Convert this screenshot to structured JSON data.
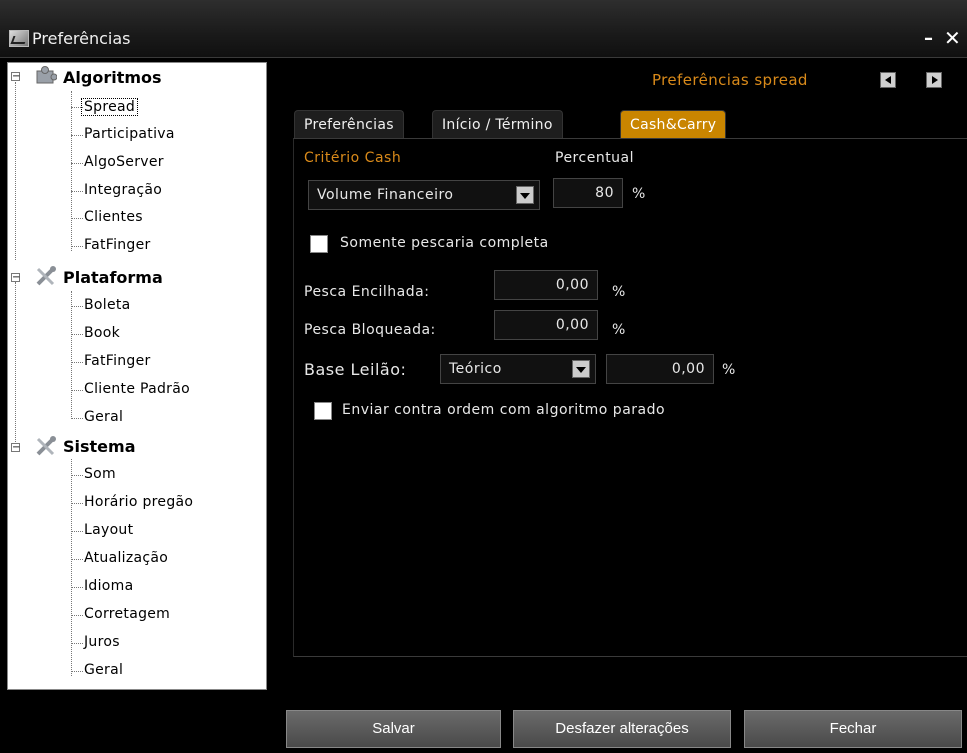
{
  "window": {
    "title": "Preferências"
  },
  "tree": {
    "categories": [
      {
        "label": "Algoritmos",
        "icon": "puzzle-icon",
        "items": [
          "Spread",
          "Participativa",
          "AlgoServer",
          "Integração",
          "Clientes",
          "FatFinger"
        ]
      },
      {
        "label": "Plataforma",
        "icon": "tools-icon",
        "items": [
          "Boleta",
          "Book",
          "FatFinger",
          "Cliente Padrão",
          "Geral"
        ]
      },
      {
        "label": "Sistema",
        "icon": "tools-icon",
        "items": [
          "Som",
          "Horário pregão",
          "Layout",
          "Atualização",
          "Idioma",
          "Corretagem",
          "Juros",
          "Geral"
        ]
      }
    ],
    "selected": "Spread"
  },
  "header": {
    "title": "Preferências spread"
  },
  "tabs": [
    {
      "label": "Preferências",
      "active": false
    },
    {
      "label": "Início / Término",
      "active": false
    },
    {
      "label": "Cash&Carry",
      "active": true
    }
  ],
  "form": {
    "criterio_label": "Critério Cash",
    "percentual_label": "Percentual",
    "criterio_value": "Volume Financeiro",
    "percentual_value": "80",
    "percent_symbol": "%",
    "somente_label": "Somente pescaria completa",
    "somente_checked": false,
    "pesca_encilhada_label": "Pesca Encilhada:",
    "pesca_encilhada_value": "0,00",
    "pesca_bloqueada_label": "Pesca Bloqueada:",
    "pesca_bloqueada_value": "0,00",
    "base_leilao_label": "Base Leilão:",
    "base_leilao_value": "Teórico",
    "base_leilao_pct": "0,00",
    "enviar_label": "Enviar contra ordem com algoritmo parado",
    "enviar_checked": false
  },
  "buttons": {
    "save": "Salvar",
    "undo": "Desfazer alterações",
    "close": "Fechar"
  },
  "colors": {
    "accent": "#d98a1a",
    "active_tab": "#c98500",
    "background": "#000000"
  }
}
